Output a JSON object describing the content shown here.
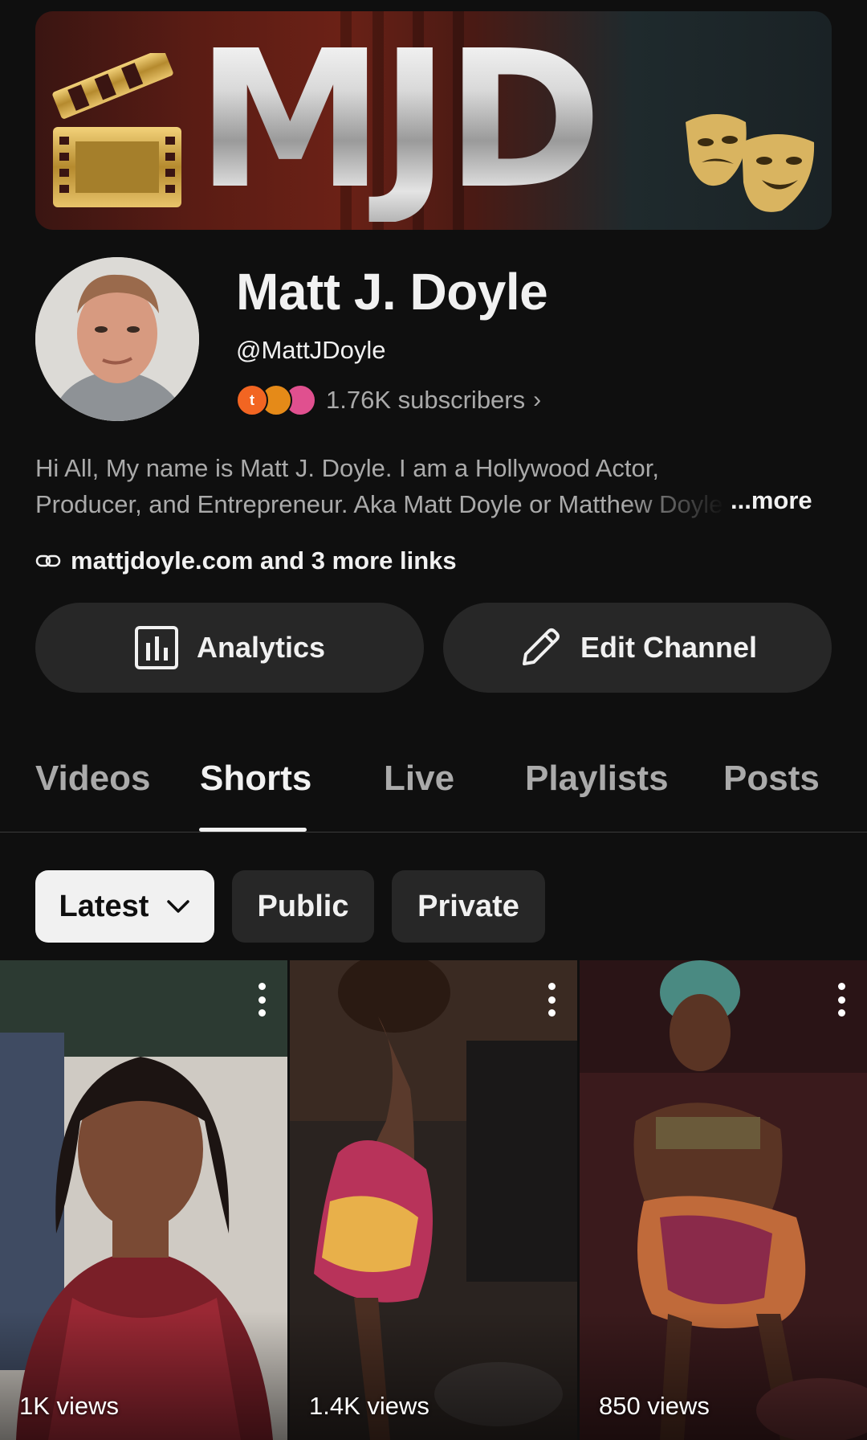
{
  "banner": {
    "logo_text": "MJD"
  },
  "channel": {
    "name": "Matt J. Doyle",
    "handle": "@MattJDoyle",
    "subscriber_avatar_letter": "t",
    "subscribers": "1.76K subscribers",
    "description_line1": "Hi All, My name is Matt J. Doyle. I am a Hollywood Actor,",
    "description_line2": "Producer, and Entrepreneur. Aka Matt Doyle or Matthew Doyle",
    "more_label": "...more",
    "links_text": "mattjdoyle.com and 3 more links"
  },
  "actions": {
    "analytics_label": "Analytics",
    "edit_label": "Edit Channel"
  },
  "tabs": [
    {
      "label": "Videos"
    },
    {
      "label": "Shorts",
      "active": true
    },
    {
      "label": "Live"
    },
    {
      "label": "Playlists"
    },
    {
      "label": "Posts"
    }
  ],
  "filters": {
    "sort_label": "Latest",
    "public_label": "Public",
    "private_label": "Private"
  },
  "shorts": [
    {
      "views": "1K views"
    },
    {
      "views": "1.4K views"
    },
    {
      "views": "850 views"
    }
  ],
  "colors": {
    "background": "#0f0f0f",
    "surface": "#272727",
    "text_primary": "#f1f1f1",
    "text_secondary": "#aaaaaa"
  }
}
